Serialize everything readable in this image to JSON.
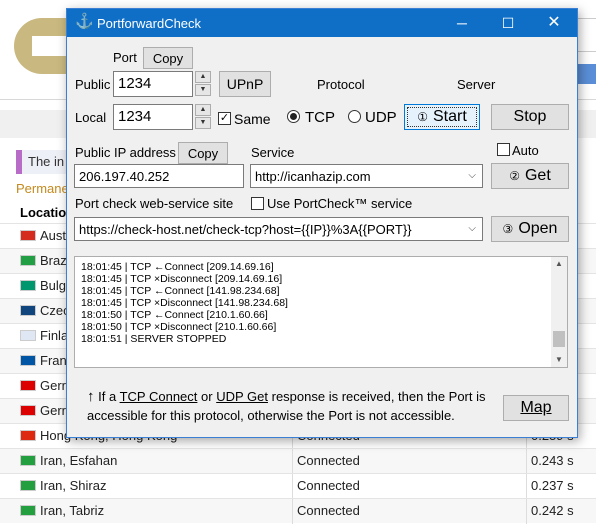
{
  "background": {
    "note_text": "The in",
    "permanent_text": "Permane",
    "location_header": "Locatio",
    "rows": [
      {
        "country": "Aust",
        "flag": "#d52b1e",
        "status": "",
        "time": ""
      },
      {
        "country": "Braz",
        "flag": "#229e45",
        "status": "",
        "time": ""
      },
      {
        "country": "Bulg",
        "flag": "#00966e",
        "status": "",
        "time": ""
      },
      {
        "country": "Czec",
        "flag": "#11457e",
        "status": "",
        "time": ""
      },
      {
        "country": "Finla",
        "flag": "#dfe7f4",
        "status": "",
        "time": ""
      },
      {
        "country": "Fran",
        "flag": "#0055a4",
        "status": "",
        "time": ""
      },
      {
        "country": "Gerr",
        "flag": "#dd0000",
        "status": "",
        "time": ""
      },
      {
        "country": "Gerr",
        "flag": "#dd0000",
        "status": "",
        "time": ""
      },
      {
        "country": "Hong Kong, Hong Kong",
        "flag": "#de2910",
        "status": "Connected",
        "time": "0.259 s"
      },
      {
        "country": "Iran, Esfahan",
        "flag": "#239f40",
        "status": "Connected",
        "time": "0.243 s"
      },
      {
        "country": "Iran, Shiraz",
        "flag": "#239f40",
        "status": "Connected",
        "time": "0.237 s"
      },
      {
        "country": "Iran, Tabriz",
        "flag": "#239f40",
        "status": "Connected",
        "time": "0.242 s"
      }
    ]
  },
  "window": {
    "title": "PortforwardCheck",
    "title_icon": "anchor-icon",
    "accent": "#0f6fc6"
  },
  "port": {
    "label": "Port",
    "copy_label": "Copy",
    "public_label": "Public",
    "public_value": "1234",
    "upnp_label": "UPnP",
    "local_label": "Local",
    "local_value": "1234",
    "same_label": "Same",
    "same_checked": true
  },
  "protocol": {
    "label": "Protocol",
    "tcp_label": "TCP",
    "udp_label": "UDP",
    "selected": "TCP"
  },
  "server": {
    "label": "Server",
    "start_label": "Start",
    "stop_label": "Stop"
  },
  "public_ip": {
    "label": "Public IP address",
    "copy_label": "Copy",
    "value": "206.197.40.252"
  },
  "service": {
    "label": "Service",
    "value": "http://icanhazip.com",
    "auto_label": "Auto",
    "auto_checked": false,
    "get_label": "Get"
  },
  "check": {
    "label": "Port check web-service site",
    "use_label": "Use PortCheck™ service",
    "use_checked": false,
    "url": "https://check-host.net/check-tcp?host={{IP}}%3A{{PORT}}",
    "open_label": "Open"
  },
  "log": [
    "18:01:45 | TCP ←Connect [209.14.69.16]",
    "18:01:45 | TCP ×Disconnect [209.14.69.16]",
    "18:01:45 | TCP ←Connect [141.98.234.68]",
    "18:01:45 | TCP ×Disconnect [141.98.234.68]",
    "18:01:50 | TCP ←Connect [210.1.60.66]",
    "18:01:50 | TCP ×Disconnect [210.1.60.66]",
    "18:01:51 | SERVER STOPPED"
  ],
  "info": {
    "arrow": "↑",
    "part1": "If a",
    "tcp_connect": "TCP Connect",
    "part2": "or",
    "udp_get": "UDP Get",
    "part3": "response is received, then the Port is accessible for this protocol, otherwise the Port is not accessible."
  },
  "map_label": "Map"
}
